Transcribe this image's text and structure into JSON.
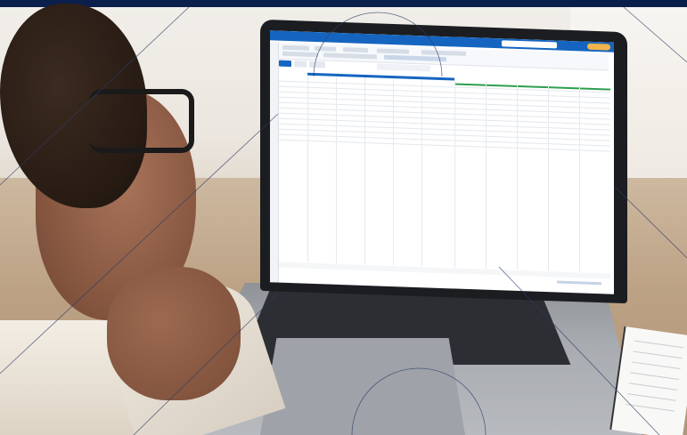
{
  "photo": {
    "subject": "",
    "screen": {
      "app_title": "",
      "accent_color": "#1565c0",
      "header_color": "#1565c0",
      "highlight_color": "#2e9e4f"
    }
  },
  "colors": {
    "top_band": "#0b1f4d",
    "overlay_lines": "#2c3e66"
  }
}
